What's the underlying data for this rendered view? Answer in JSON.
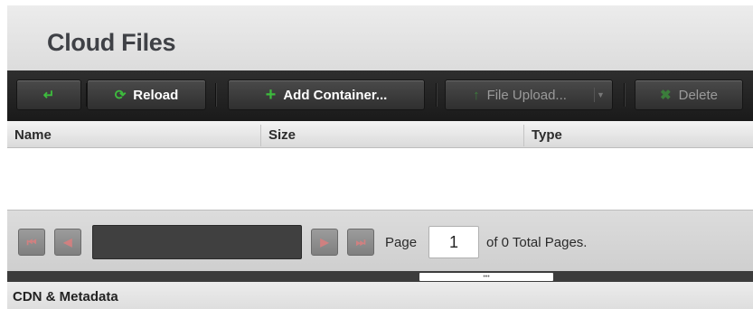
{
  "header": {
    "title": "Cloud Files"
  },
  "toolbar": {
    "back_icon": "back-arrow-icon",
    "reload_label": "Reload",
    "add_container_label": "Add Container...",
    "file_upload_label": "File Upload...",
    "delete_label": "Delete",
    "colors": {
      "accent": "#3dbb3d",
      "bar": "#222222"
    }
  },
  "table": {
    "columns": [
      "Name",
      "Size",
      "Type"
    ],
    "rows": []
  },
  "pager": {
    "page_label": "Page",
    "page_value": "1",
    "total_text": "of 0 Total Pages.",
    "nav_icons": [
      "first-page-icon",
      "prev-page-icon",
      "next-page-icon",
      "last-page-icon"
    ]
  },
  "bottom_panel": {
    "title": "CDN & Metadata"
  }
}
